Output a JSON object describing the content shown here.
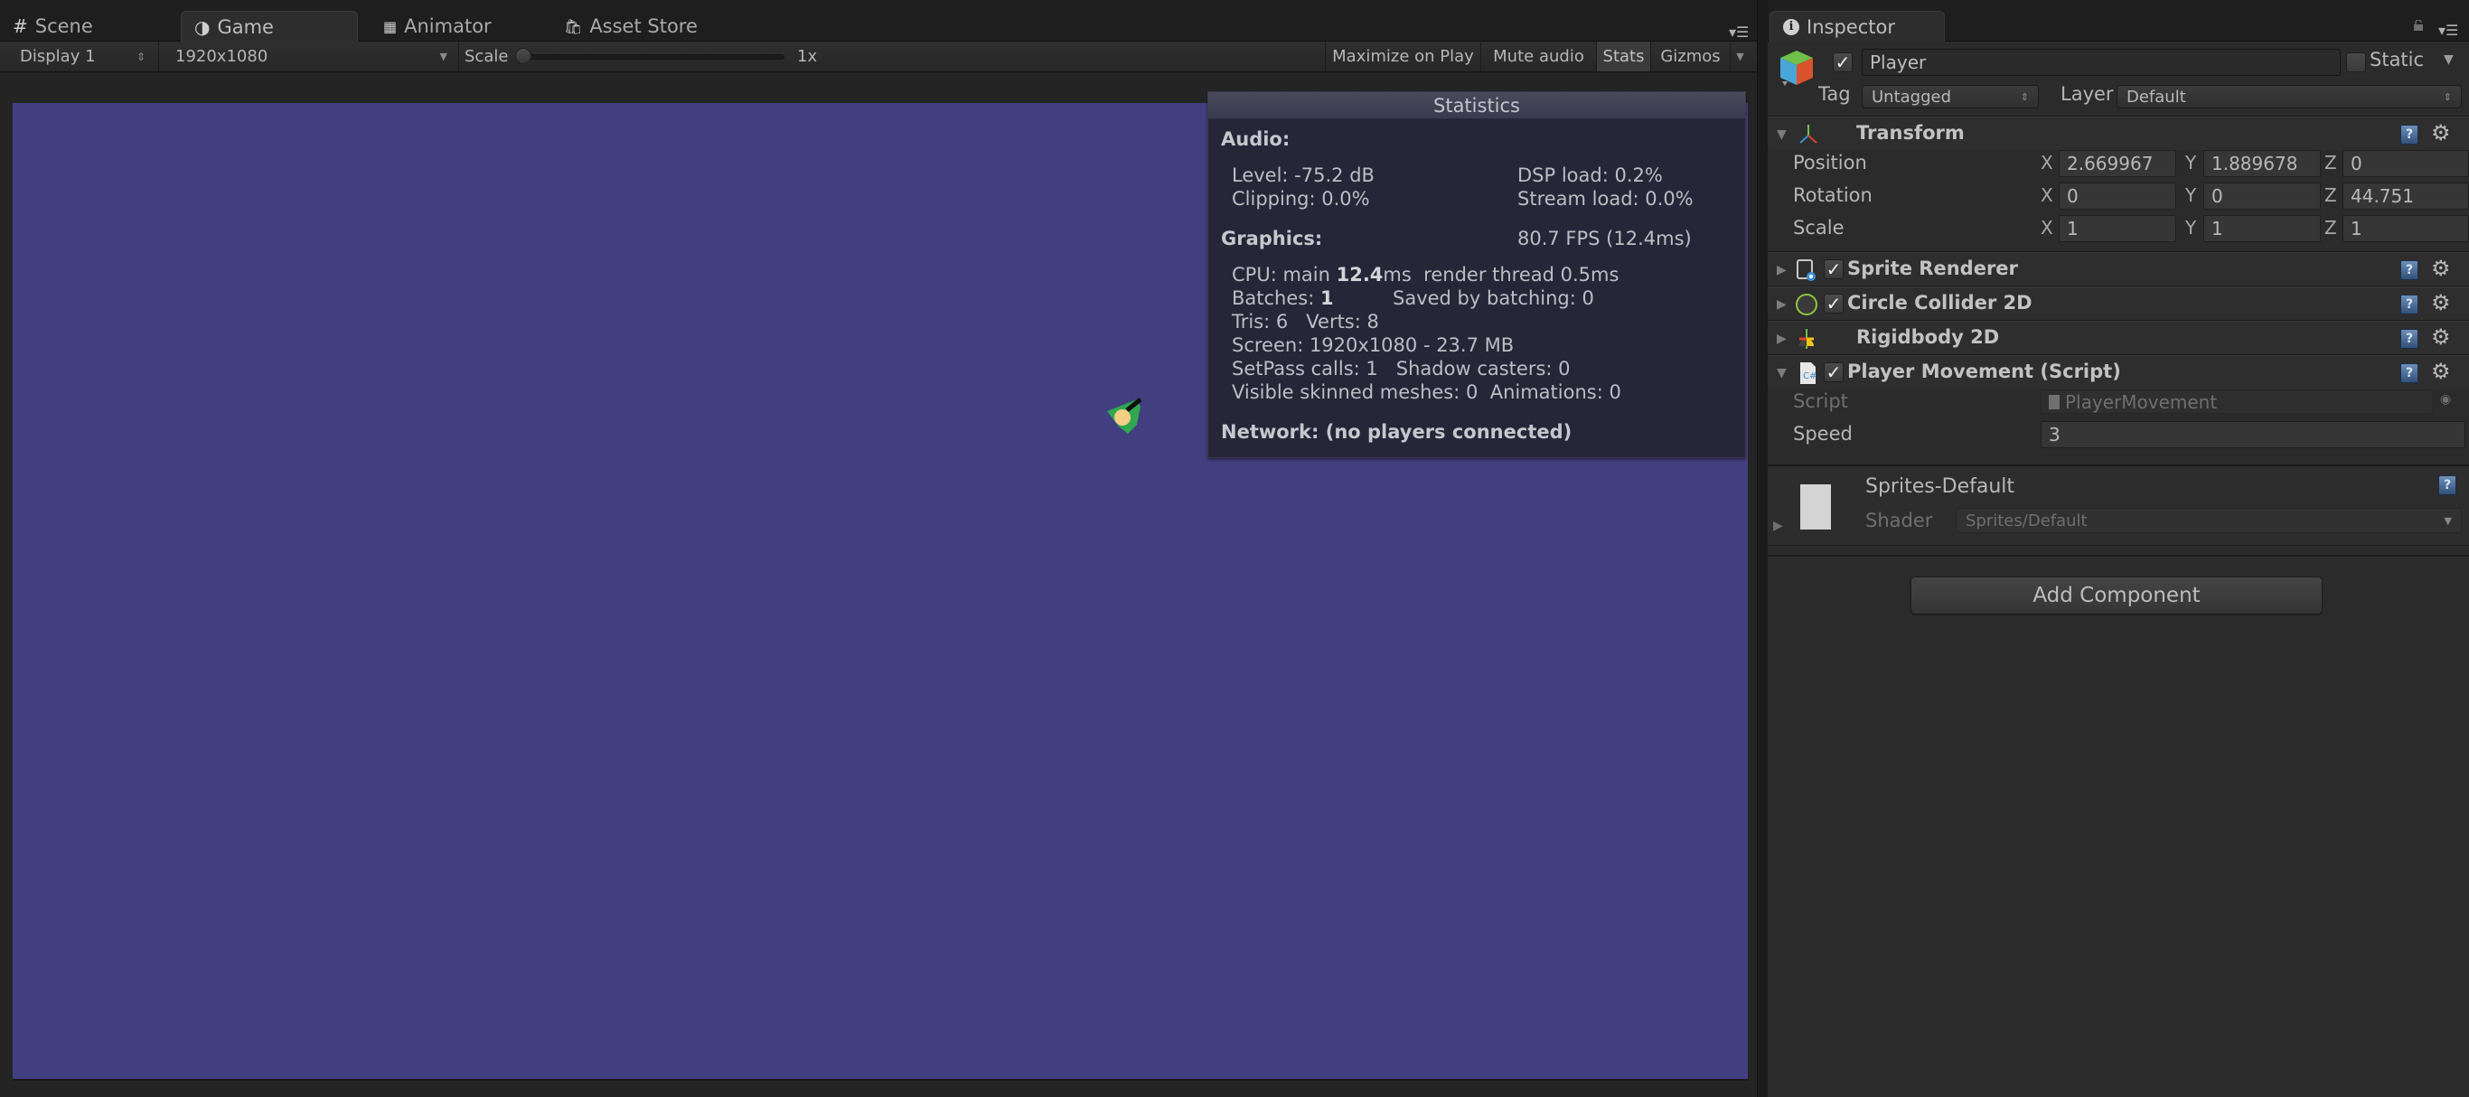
{
  "tabs": {
    "scene": "Scene",
    "game": "Game",
    "animator": "Animator",
    "asset_store": "Asset Store"
  },
  "toolbar": {
    "display": "Display 1",
    "resolution": "1920x1080",
    "scale_label": "Scale",
    "scale_value": "1x",
    "scale_fraction": 0.0,
    "maximize_on_play": "Maximize on Play",
    "mute_audio": "Mute audio",
    "stats": "Stats",
    "stats_active": true,
    "gizmos": "Gizmos"
  },
  "game_view": {
    "background_color": "#423f80"
  },
  "statistics": {
    "title": "Statistics",
    "audio_heading": "Audio:",
    "level": "Level: -75.2 dB",
    "clipping": "Clipping: 0.0%",
    "dsp_load": "DSP load: 0.2%",
    "stream_load": "Stream load: 0.0%",
    "graphics_heading": "Graphics:",
    "fps": "80.7 FPS (12.4ms)",
    "cpu_prefix": "CPU: main ",
    "cpu_main": "12.4",
    "cpu_suffix": "ms  render thread 0.5ms",
    "batches_prefix": "Batches: ",
    "batches": "1",
    "saved_by_batching": "Saved by batching: 0",
    "tris_verts": "Tris: 6   Verts: 8",
    "screen": "Screen: 1920x1080 - 23.7 MB",
    "setpass": "SetPass calls: 1   Shadow casters: 0",
    "skinned": "Visible skinned meshes: 0  Animations: 0",
    "network": "Network: (no players connected)"
  },
  "inspector": {
    "tab": "Inspector",
    "object": {
      "active": true,
      "name": "Player",
      "static_label": "Static",
      "static": false,
      "tag_label": "Tag",
      "tag": "Untagged",
      "layer_label": "Layer",
      "layer": "Default"
    },
    "transform": {
      "title": "Transform",
      "rows": [
        {
          "label": "Position",
          "x": "2.669967",
          "y": "1.889678",
          "z": "0"
        },
        {
          "label": "Rotation",
          "x": "0",
          "y": "0",
          "z": "44.751"
        },
        {
          "label": "Scale",
          "x": "1",
          "y": "1",
          "z": "1"
        }
      ],
      "axis_x": "X",
      "axis_y": "Y",
      "axis_z": "Z"
    },
    "components": [
      {
        "title": "Sprite Renderer",
        "enabled": true
      },
      {
        "title": "Circle Collider 2D",
        "enabled": true
      },
      {
        "title": "Rigidbody 2D"
      },
      {
        "title": "Player Movement (Script)",
        "enabled": true
      }
    ],
    "player_movement": {
      "script_label": "Script",
      "script_value": "PlayerMovement",
      "speed_label": "Speed",
      "speed_value": "3"
    },
    "material": {
      "name": "Sprites-Default",
      "shader_label": "Shader",
      "shader_value": "Sprites/Default"
    },
    "add_component": "Add Component"
  }
}
